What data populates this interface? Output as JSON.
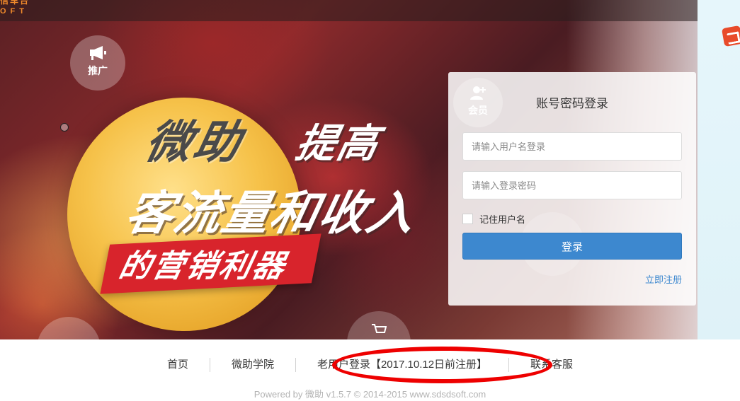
{
  "brand": {
    "name": "信车台",
    "sub": "OFT",
    "color": "#f08a2b"
  },
  "hero": {
    "icons": [
      {
        "icon": "megaphone-icon",
        "label": "推广"
      },
      {
        "icon": "user-plus-icon",
        "label": "会员"
      }
    ],
    "promo": {
      "line1a": "微助",
      "line1b": "提高",
      "line2": "客流量和收入",
      "line3": "的营销利器"
    }
  },
  "login": {
    "title": "账号密码登录",
    "username_placeholder": "请输入用户名登录",
    "password_placeholder": "请输入登录密码",
    "remember_label": "记住用户名",
    "submit_label": "登录",
    "register_label": "立即注册",
    "accent_color": "#3d88cf"
  },
  "footer": {
    "links": [
      {
        "label": "首页"
      },
      {
        "label": "微助学院"
      },
      {
        "label": "老用户登录【2017.10.12日前注册】"
      },
      {
        "label": "联系客服"
      }
    ],
    "powered": "Powered by 微助 v1.5.7 © 2014-2015 www.sdsdsoft.com"
  },
  "annotation": {
    "color": "#ee0000"
  }
}
